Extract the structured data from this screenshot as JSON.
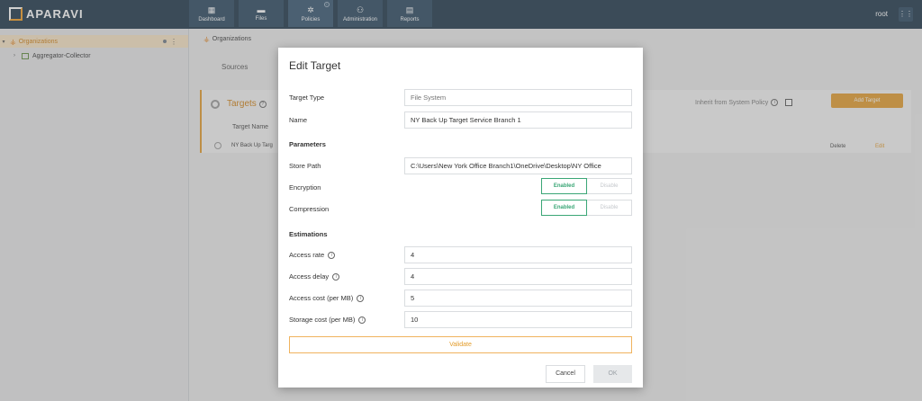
{
  "app": {
    "logo_text": "APARAVI",
    "user": "root"
  },
  "nav": [
    {
      "label": "Dashboard",
      "icon": "dashboard-icon"
    },
    {
      "label": "Files",
      "icon": "folder-icon"
    },
    {
      "label": "Policies",
      "icon": "gear-icon"
    },
    {
      "label": "Administration",
      "icon": "users-icon"
    },
    {
      "label": "Reports",
      "icon": "report-icon"
    }
  ],
  "sidebar": {
    "items": [
      {
        "label": "Organizations"
      },
      {
        "label": "Aggregator-Collector"
      }
    ]
  },
  "main": {
    "breadcrumb": "Organizations",
    "tab": "Sources",
    "panel_title": "Targets",
    "inherit_label": "Inherit from System Policy",
    "add_label": "Add Target",
    "column_header": "Target Name",
    "row_name": "NY Back Up Targ",
    "row_delete": "Delete",
    "row_edit": "Edit"
  },
  "modal": {
    "title": "Edit Target",
    "target_type_label": "Target Type",
    "target_type_placeholder": "File System",
    "name_label": "Name",
    "name_value": "NY Back Up Target Service Branch 1",
    "parameters_heading": "Parameters",
    "store_path_label": "Store Path",
    "store_path_value": "C:\\Users\\New York Office Branch1\\OneDrive\\Desktop\\NY Office",
    "encryption_label": "Encryption",
    "compression_label": "Compression",
    "enabled_label": "Enabled",
    "disable_label": "Disable",
    "estimations_heading": "Estimations",
    "access_rate_label": "Access rate",
    "access_rate_value": "4",
    "access_delay_label": "Access delay",
    "access_delay_value": "4",
    "access_cost_label": "Access cost (per MB)",
    "access_cost_value": "5",
    "storage_cost_label": "Storage cost (per MB)",
    "storage_cost_value": "10",
    "validate_label": "Validate",
    "cancel_label": "Cancel",
    "ok_label": "OK"
  },
  "colors": {
    "accent": "#e39c2b",
    "topbar": "#1b3348",
    "enabled": "#3aa676"
  }
}
